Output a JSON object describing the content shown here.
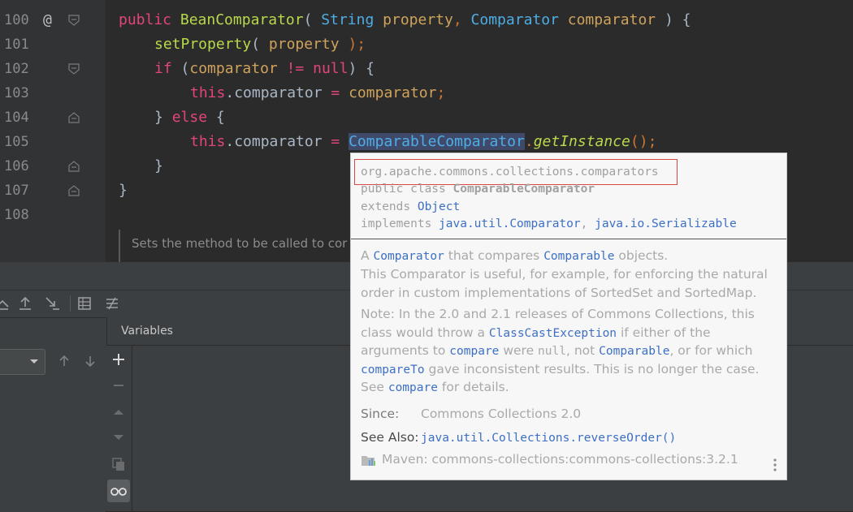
{
  "editor": {
    "line_numbers": [
      "100",
      "101",
      "102",
      "103",
      "104",
      "105",
      "106",
      "107",
      "108"
    ],
    "annotation_marker": "@",
    "lines": [
      {
        "parts": [
          [
            "kw2",
            "public"
          ],
          [
            "",
            "&nbsp;"
          ],
          [
            "fn",
            "BeanComparator"
          ],
          [
            "",
            "( "
          ],
          [
            "ty",
            "String"
          ],
          [
            "",
            ""
          ],
          [
            "par",
            " property"
          ],
          [
            "kw",
            ","
          ],
          [
            "",
            " "
          ],
          [
            "ty",
            "Comparator"
          ],
          [
            "",
            " "
          ],
          [
            "par",
            "comparator"
          ],
          [
            "",
            " ) {"
          ]
        ]
      },
      {
        "parts": []
      },
      {
        "parts": []
      }
    ],
    "code_text": {
      "l100_a": "public",
      "l100_b": "BeanComparator",
      "l100_c": "( ",
      "l100_d": "String",
      "l100_e": " property",
      "l100_f": ", ",
      "l100_g": "Comparator",
      "l100_h": " comparator",
      "l100_i": " ) {",
      "l101_a": "setProperty",
      "l101_b": "( ",
      "l101_c": "property",
      "l101_d": " );",
      "l102_a": "if",
      "l102_b": " (",
      "l102_c": "comparator",
      "l102_d": " != ",
      "l102_e": "null",
      "l102_f": ") {",
      "l103_a": "this",
      "l103_b": ".comparator",
      "l103_c": " = ",
      "l103_d": "comparator",
      "l103_e": ";",
      "l104_a": "} ",
      "l104_b": "else",
      "l104_c": " {",
      "l105_a": "this",
      "l105_b": ".comparator",
      "l105_c": " = ",
      "l105_d": "ComparableComparator",
      "l105_e": ".",
      "l105_f": "getInstance",
      "l105_g": "();",
      "l106_a": "}",
      "l107_a": "}"
    },
    "doc_comment_preview": "Sets the method to be called to cor"
  },
  "debug": {
    "variables_label": "Variables"
  },
  "popup": {
    "package": "org.apache.commons.collections.comparators",
    "decl_public": "public class ",
    "decl_class": "ComparableComparator",
    "extends_kw": "extends ",
    "extends_type": "Object",
    "implements_kw": "implements ",
    "impl_1": "java.util.Comparator",
    "impl_sep": ", ",
    "impl_2": "java.io.Serializable",
    "desc_a": "A ",
    "desc_link1": "Comparator",
    "desc_b": " that compares ",
    "desc_link2": "Comparable",
    "desc_c": " objects.",
    "desc_line2": "This Comparator is useful, for example, for enforcing the natural",
    "desc_line3": "order in custom implementations of SortedSet and SortedMap.",
    "note_line1": "Note: In the 2.0 and 2.1 releases of Commons Collections, this",
    "note_l2_a": "class would throw a ",
    "note_l2_link": "ClassCastException",
    "note_l2_b": " if either of the",
    "note_l3_a": "arguments to ",
    "note_l3_link": "compare",
    "note_l3_b": " were ",
    "note_l3_null": "null",
    "note_l3_c": ", not ",
    "note_l3_link2": "Comparable",
    "note_l3_d": ", or for which",
    "note_l4_link": "compareTo",
    "note_l4_b": " gave inconsistent results. This is no longer the case.",
    "note_l5_a": "See ",
    "note_l5_link": "compare",
    "note_l5_b": " for details.",
    "since_label": "Since:",
    "since_value": "Commons Collections 2.0",
    "see_also_label": "See Also:",
    "see_also_link": "java.util.Collections.reverseOrder()",
    "maven_text": "Maven: commons-collections:commons-collections:3.2.1",
    "more_icon": "more-vertical-icon"
  },
  "colors": {
    "editor_bg": "#2b2b2b",
    "keyword": "#e2457b",
    "type": "#4eade5",
    "param": "#d0a35c",
    "function": "#b8d94b",
    "popup_bg": "#f7f7f7",
    "popup_link": "#3d6fc4",
    "highlight_border": "#d94848"
  }
}
